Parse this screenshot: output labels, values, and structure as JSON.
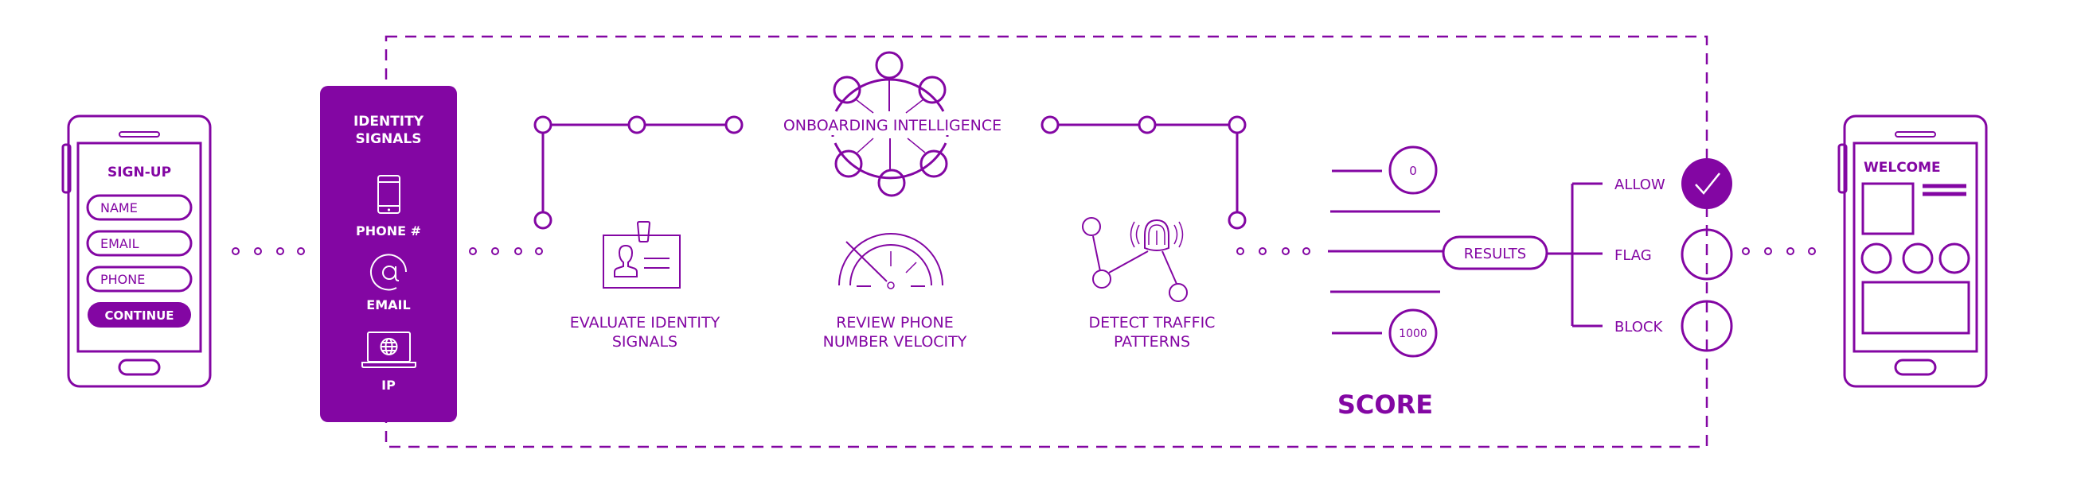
{
  "colors": {
    "accent": "#8306a3",
    "background": "#ffffff",
    "on_accent": "#ffffff"
  },
  "signup_phone": {
    "title": "SIGN-UP",
    "fields": [
      "NAME",
      "EMAIL",
      "PHONE"
    ],
    "continue_label": "CONTINUE"
  },
  "identity_signals": {
    "title_line1": "IDENTITY",
    "title_line2": "SIGNALS",
    "items": [
      {
        "label": "PHONE #",
        "icon": "smartphone-icon"
      },
      {
        "label": "EMAIL",
        "icon": "at-sign-icon"
      },
      {
        "label": "IP",
        "icon": "laptop-globe-icon"
      }
    ]
  },
  "onboarding": {
    "title": "ONBOARDING INTELLIGENCE",
    "icon": "network-hub-icon"
  },
  "steps": [
    {
      "line1": "EVALUATE IDENTITY",
      "line2": "SIGNALS",
      "icon": "id-badge-icon"
    },
    {
      "line1": "REVIEW PHONE",
      "line2": "NUMBER VELOCITY",
      "icon": "speedometer-icon"
    },
    {
      "line1": "DETECT TRAFFIC",
      "line2": "PATTERNS",
      "icon": "fingerprint-network-icon"
    }
  ],
  "score": {
    "title": "SCORE",
    "min_label": "0",
    "max_label": "1000",
    "results_label": "RESULTS"
  },
  "outcomes": [
    {
      "label": "ALLOW",
      "selected": true,
      "icon": "check-icon"
    },
    {
      "label": "FLAG",
      "selected": false
    },
    {
      "label": "BLOCK",
      "selected": false
    }
  ],
  "welcome_phone": {
    "title": "WELCOME"
  }
}
